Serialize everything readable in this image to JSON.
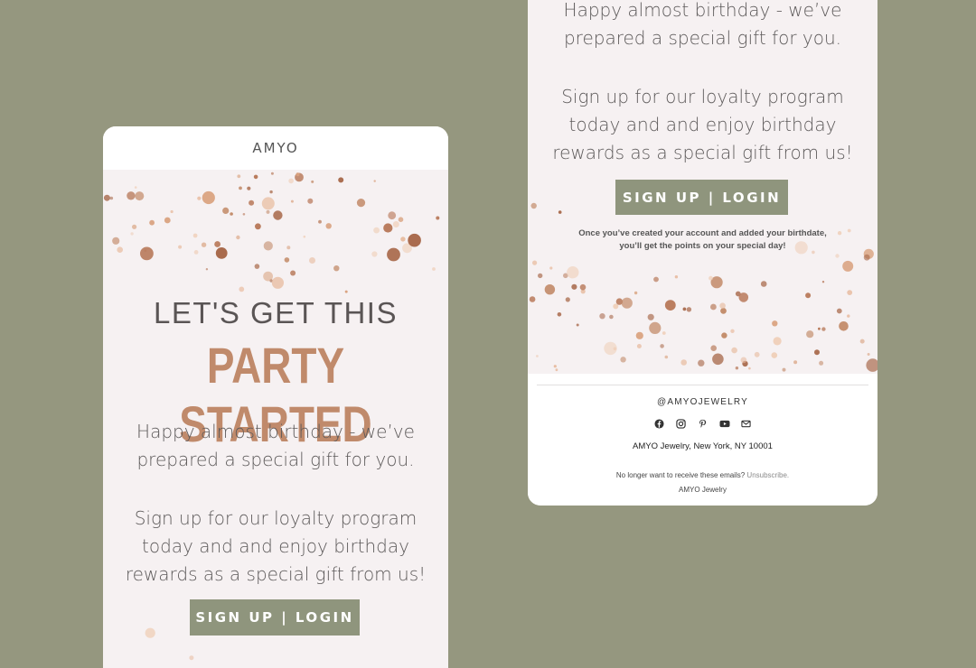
{
  "colors": {
    "background": "#95977f",
    "card": "#f6f1f2",
    "accent_copper": "#c08a6b",
    "button": "#8f957d",
    "text": "#5d5a5a"
  },
  "left_card": {
    "brand": "AMYO",
    "headline_line1": "LET'S GET THIS",
    "headline_line2": "PARTY STARTED",
    "paragraph1_line1": "Happy almost birthday - we’ve",
    "paragraph1_line2": "prepared a special gift for you.",
    "paragraph2_line1": "Sign up for our loyalty program",
    "paragraph2_line2": "today and and enjoy birthday",
    "paragraph2_line3": "rewards as a special gift from us!",
    "cta_label": "SIGN UP | LOGIN"
  },
  "right_card": {
    "paragraph1_line1": "Happy almost birthday - we’ve",
    "paragraph1_line2": "prepared a special gift for you.",
    "paragraph2_line1": "Sign up for our loyalty program",
    "paragraph2_line2": "today and and enjoy birthday",
    "paragraph2_line3": "rewards as a special gift from us!",
    "cta_label": "SIGN UP | LOGIN",
    "note_line1": "Once you’ve created your account and added your birthdate,",
    "note_line2": "you’ll get the points on your special day!"
  },
  "footer": {
    "handle": "@AMYOJEWELRY",
    "social_icons": [
      "facebook-icon",
      "instagram-icon",
      "pinterest-icon",
      "youtube-icon",
      "email-icon"
    ],
    "address": "AMYO Jewelry, New York, NY 10001",
    "unsubscribe_prefix": "No longer want to receive these emails?",
    "unsubscribe_link": "Unsubscribe.",
    "company": "AMYO Jewelry"
  }
}
